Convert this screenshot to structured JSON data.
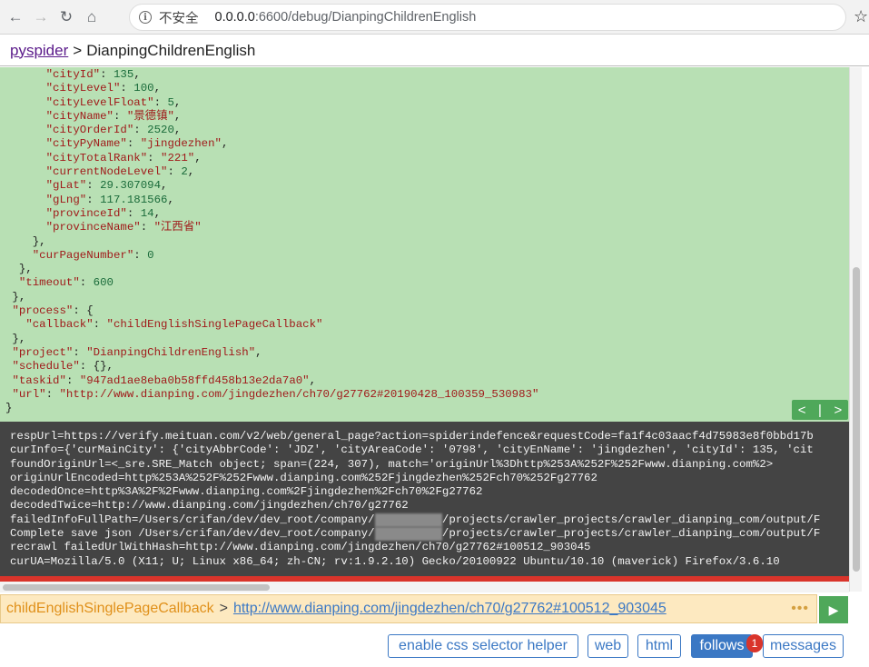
{
  "browser": {
    "insecure_label": "不安全",
    "url_host": "0.0.0.0",
    "url_rest": ":6600/debug/DianpingChildrenEnglish"
  },
  "header": {
    "home_link": "pyspider",
    "separator": ">",
    "project_name": "DianpingChildrenEnglish"
  },
  "json_lines": [
    [
      {
        "t": "      "
      },
      {
        "t": "\"cityId\"",
        "c": "k"
      },
      {
        "t": ": "
      },
      {
        "t": "135",
        "c": "n"
      },
      {
        "t": ","
      }
    ],
    [
      {
        "t": "      "
      },
      {
        "t": "\"cityLevel\"",
        "c": "k"
      },
      {
        "t": ": "
      },
      {
        "t": "100",
        "c": "n"
      },
      {
        "t": ","
      }
    ],
    [
      {
        "t": "      "
      },
      {
        "t": "\"cityLevelFloat\"",
        "c": "k"
      },
      {
        "t": ": "
      },
      {
        "t": "5",
        "c": "n"
      },
      {
        "t": ","
      }
    ],
    [
      {
        "t": "      "
      },
      {
        "t": "\"cityName\"",
        "c": "k"
      },
      {
        "t": ": "
      },
      {
        "t": "\"景德镇\"",
        "c": "s"
      },
      {
        "t": ","
      }
    ],
    [
      {
        "t": "      "
      },
      {
        "t": "\"cityOrderId\"",
        "c": "k"
      },
      {
        "t": ": "
      },
      {
        "t": "2520",
        "c": "n"
      },
      {
        "t": ","
      }
    ],
    [
      {
        "t": "      "
      },
      {
        "t": "\"cityPyName\"",
        "c": "k"
      },
      {
        "t": ": "
      },
      {
        "t": "\"jingdezhen\"",
        "c": "s"
      },
      {
        "t": ","
      }
    ],
    [
      {
        "t": "      "
      },
      {
        "t": "\"cityTotalRank\"",
        "c": "k"
      },
      {
        "t": ": "
      },
      {
        "t": "\"221\"",
        "c": "s"
      },
      {
        "t": ","
      }
    ],
    [
      {
        "t": "      "
      },
      {
        "t": "\"currentNodeLevel\"",
        "c": "k"
      },
      {
        "t": ": "
      },
      {
        "t": "2",
        "c": "n"
      },
      {
        "t": ","
      }
    ],
    [
      {
        "t": "      "
      },
      {
        "t": "\"gLat\"",
        "c": "k"
      },
      {
        "t": ": "
      },
      {
        "t": "29.307094",
        "c": "n"
      },
      {
        "t": ","
      }
    ],
    [
      {
        "t": "      "
      },
      {
        "t": "\"gLng\"",
        "c": "k"
      },
      {
        "t": ": "
      },
      {
        "t": "117.181566",
        "c": "n"
      },
      {
        "t": ","
      }
    ],
    [
      {
        "t": "      "
      },
      {
        "t": "\"provinceId\"",
        "c": "k"
      },
      {
        "t": ": "
      },
      {
        "t": "14",
        "c": "n"
      },
      {
        "t": ","
      }
    ],
    [
      {
        "t": "      "
      },
      {
        "t": "\"provinceName\"",
        "c": "k"
      },
      {
        "t": ": "
      },
      {
        "t": "\"江西省\"",
        "c": "s"
      }
    ],
    [
      {
        "t": "    },"
      }
    ],
    [
      {
        "t": "    "
      },
      {
        "t": "\"curPageNumber\"",
        "c": "k"
      },
      {
        "t": ": "
      },
      {
        "t": "0",
        "c": "n"
      }
    ],
    [
      {
        "t": "  },"
      }
    ],
    [
      {
        "t": "  "
      },
      {
        "t": "\"timeout\"",
        "c": "k"
      },
      {
        "t": ": "
      },
      {
        "t": "600",
        "c": "n"
      }
    ],
    [
      {
        "t": " },"
      }
    ],
    [
      {
        "t": " "
      },
      {
        "t": "\"process\"",
        "c": "k"
      },
      {
        "t": ": {"
      }
    ],
    [
      {
        "t": "   "
      },
      {
        "t": "\"callback\"",
        "c": "k"
      },
      {
        "t": ": "
      },
      {
        "t": "\"childEnglishSinglePageCallback\"",
        "c": "s"
      }
    ],
    [
      {
        "t": " },"
      }
    ],
    [
      {
        "t": " "
      },
      {
        "t": "\"project\"",
        "c": "k"
      },
      {
        "t": ": "
      },
      {
        "t": "\"DianpingChildrenEnglish\"",
        "c": "s"
      },
      {
        "t": ","
      }
    ],
    [
      {
        "t": " "
      },
      {
        "t": "\"schedule\"",
        "c": "k"
      },
      {
        "t": ": {},"
      }
    ],
    [
      {
        "t": " "
      },
      {
        "t": "\"taskid\"",
        "c": "k"
      },
      {
        "t": ": "
      },
      {
        "t": "\"947ad1ae8eba0b58ffd458b13e2da7a0\"",
        "c": "s"
      },
      {
        "t": ","
      }
    ],
    [
      {
        "t": " "
      },
      {
        "t": "\"url\"",
        "c": "k"
      },
      {
        "t": ": "
      },
      {
        "t": "\"http://www.dianping.com/jingdezhen/ch70/g27762#20190428_100359_530983\"",
        "c": "s"
      }
    ],
    [
      {
        "t": "}"
      }
    ]
  ],
  "pager": {
    "prev": "<",
    "divider": "|",
    "next": ">"
  },
  "log_lines": [
    [
      {
        "t": "respUrl=https://verify.meituan.com/v2/web/general_page?action=spiderindefence&requestCode=fa1f4c03aacf4d75983e8f0bbd17b"
      }
    ],
    [
      {
        "t": "curInfo={'curMainCity': {'cityAbbrCode': 'JDZ', 'cityAreaCode': '0798', 'cityEnName': 'jingdezhen', 'cityId': 135, 'cit"
      }
    ],
    [
      {
        "t": "foundOriginUrl=<_sre.SRE_Match object; span=(224, 307), match='originUrl%3Dhttp%253A%252F%252Fwww.dianping.com%2>"
      }
    ],
    [
      {
        "t": "originUrlEncoded=http%253A%252F%252Fwww.dianping.com%252Fjingdezhen%252Fch70%252Fg27762"
      }
    ],
    [
      {
        "t": "decodedOnce=http%3A%2F%2Fwww.dianping.com%2Fjingdezhen%2Fch70%2Fg27762"
      }
    ],
    [
      {
        "t": "decodedTwice=http://www.dianping.com/jingdezhen/ch70/g27762"
      }
    ],
    [
      {
        "t": "failedInfoFullPath=/Users/crifan/dev/dev_root/company/"
      },
      {
        "t": "xxxxxxxxxx",
        "c": "blur"
      },
      {
        "t": "/projects/crawler_projects/crawler_dianping_com/output/F"
      }
    ],
    [
      {
        "t": "Complete save json /Users/crifan/dev/dev_root/company/"
      },
      {
        "t": "xxxxxxxxxx",
        "c": "blur"
      },
      {
        "t": "/projects/crawler_projects/crawler_dianping_com/output/F"
      }
    ],
    [
      {
        "t": "recrawl failedUrlWithHash=http://www.dianping.com/jingdezhen/ch70/g27762#100512_903045"
      }
    ],
    [
      {
        "t": "curUA=Mozilla/5.0 (X11; U; Linux x86_64; zh-CN; rv:1.9.2.10) Gecko/20100922 Ubuntu/10.10 (maverick) Firefox/3.6.10"
      }
    ]
  ],
  "callback_bar": {
    "callback_name": "childEnglishSinglePageCallback",
    "separator": ">",
    "url": "http://www.dianping.com/jingdezhen/ch70/g27762#100512_903045",
    "more": "•••"
  },
  "tabs": {
    "css_helper": "enable css selector helper",
    "web": "web",
    "html": "html",
    "follows": "follows",
    "follows_badge": "1",
    "messages": "messages"
  },
  "colors": {
    "json_bg": "#b8e0b4",
    "log_bg": "#444444",
    "accent": "#3b78c4",
    "run_green": "#4fa85a",
    "error_red": "#d9342b"
  }
}
